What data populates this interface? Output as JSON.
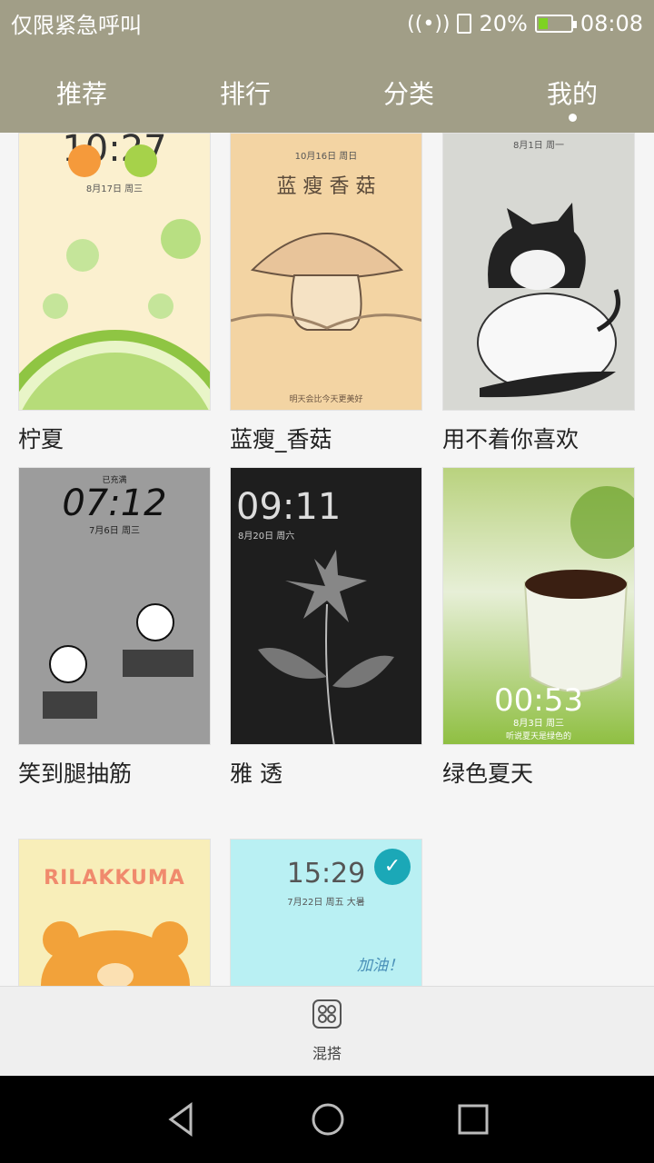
{
  "status": {
    "carrier": "仅限紧急呼叫",
    "battery": "20%",
    "time": "08:08"
  },
  "tabs": [
    {
      "label": "推荐",
      "active": false
    },
    {
      "label": "排行",
      "active": false
    },
    {
      "label": "分类",
      "active": false
    },
    {
      "label": "我的",
      "active": true
    }
  ],
  "themes": [
    {
      "title": "柠夏",
      "time": "10:27",
      "date": "8月17日 周三"
    },
    {
      "title": "蓝瘦_香菇",
      "header": "蓝 瘦 香 菇",
      "date": "10月16日 周日",
      "footer": "明天会比今天更美好"
    },
    {
      "title": "用不着你喜欢",
      "date": "8月1日 周一"
    },
    {
      "title": "笑到腿抽筋",
      "time": "07:12",
      "date": "7月6日 周三",
      "note": "已充满"
    },
    {
      "title": "雅 透",
      "time": "09:11",
      "date": "8月20日 周六"
    },
    {
      "title": "绿色夏天",
      "time": "00:53",
      "date": "8月3日 周三",
      "caption": "听说夏天是绿色的"
    },
    {
      "title": "",
      "brand": "RILAKKUMA"
    },
    {
      "title": "",
      "time": "15:29",
      "date": "7月22日 周五 大暑",
      "caption": "加油！",
      "applied": true
    }
  ],
  "bottom": {
    "mix_label": "混搭"
  },
  "colors": {
    "header": "#a19e87",
    "check": "#1ba8b7"
  }
}
